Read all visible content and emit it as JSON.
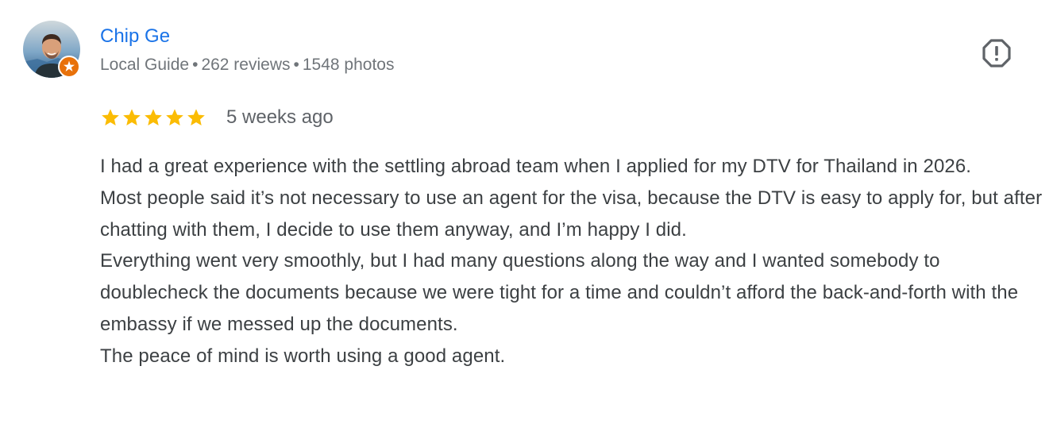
{
  "reviewer": {
    "name": "Chip Ge",
    "badge": "Local Guide",
    "reviews_count": "262 reviews",
    "photos_count": "1548 photos",
    "separator": "•",
    "avatar_icon": "person-photo",
    "badge_icon": "local-guide-star-icon"
  },
  "actions": {
    "report_icon": "report-exclamation-icon"
  },
  "rating": {
    "stars": 5,
    "max_stars": 5,
    "star_color": "#fbbc04",
    "date": "5 weeks ago"
  },
  "review_text": {
    "paragraphs": [
      "I had a great experience with the settling abroad team when I applied for my DTV for Thailand in 2026.",
      "Most people said it’s not necessary to use an agent for the visa, because the DTV is easy to apply for, but after chatting with them, I decide to use them anyway, and I’m happy I did.",
      "Everything went very smoothly, but I had many questions along the way and I wanted somebody to doublecheck the documents because we were tight for a time and couldn’t afford the back-and-forth with the embassy if we messed up the documents.",
      "The peace of mind is worth using a good agent."
    ]
  },
  "colors": {
    "name_link": "#1a73e8",
    "meta_text": "#70757a",
    "body_text": "#3c4043",
    "badge_orange": "#e8710a"
  }
}
